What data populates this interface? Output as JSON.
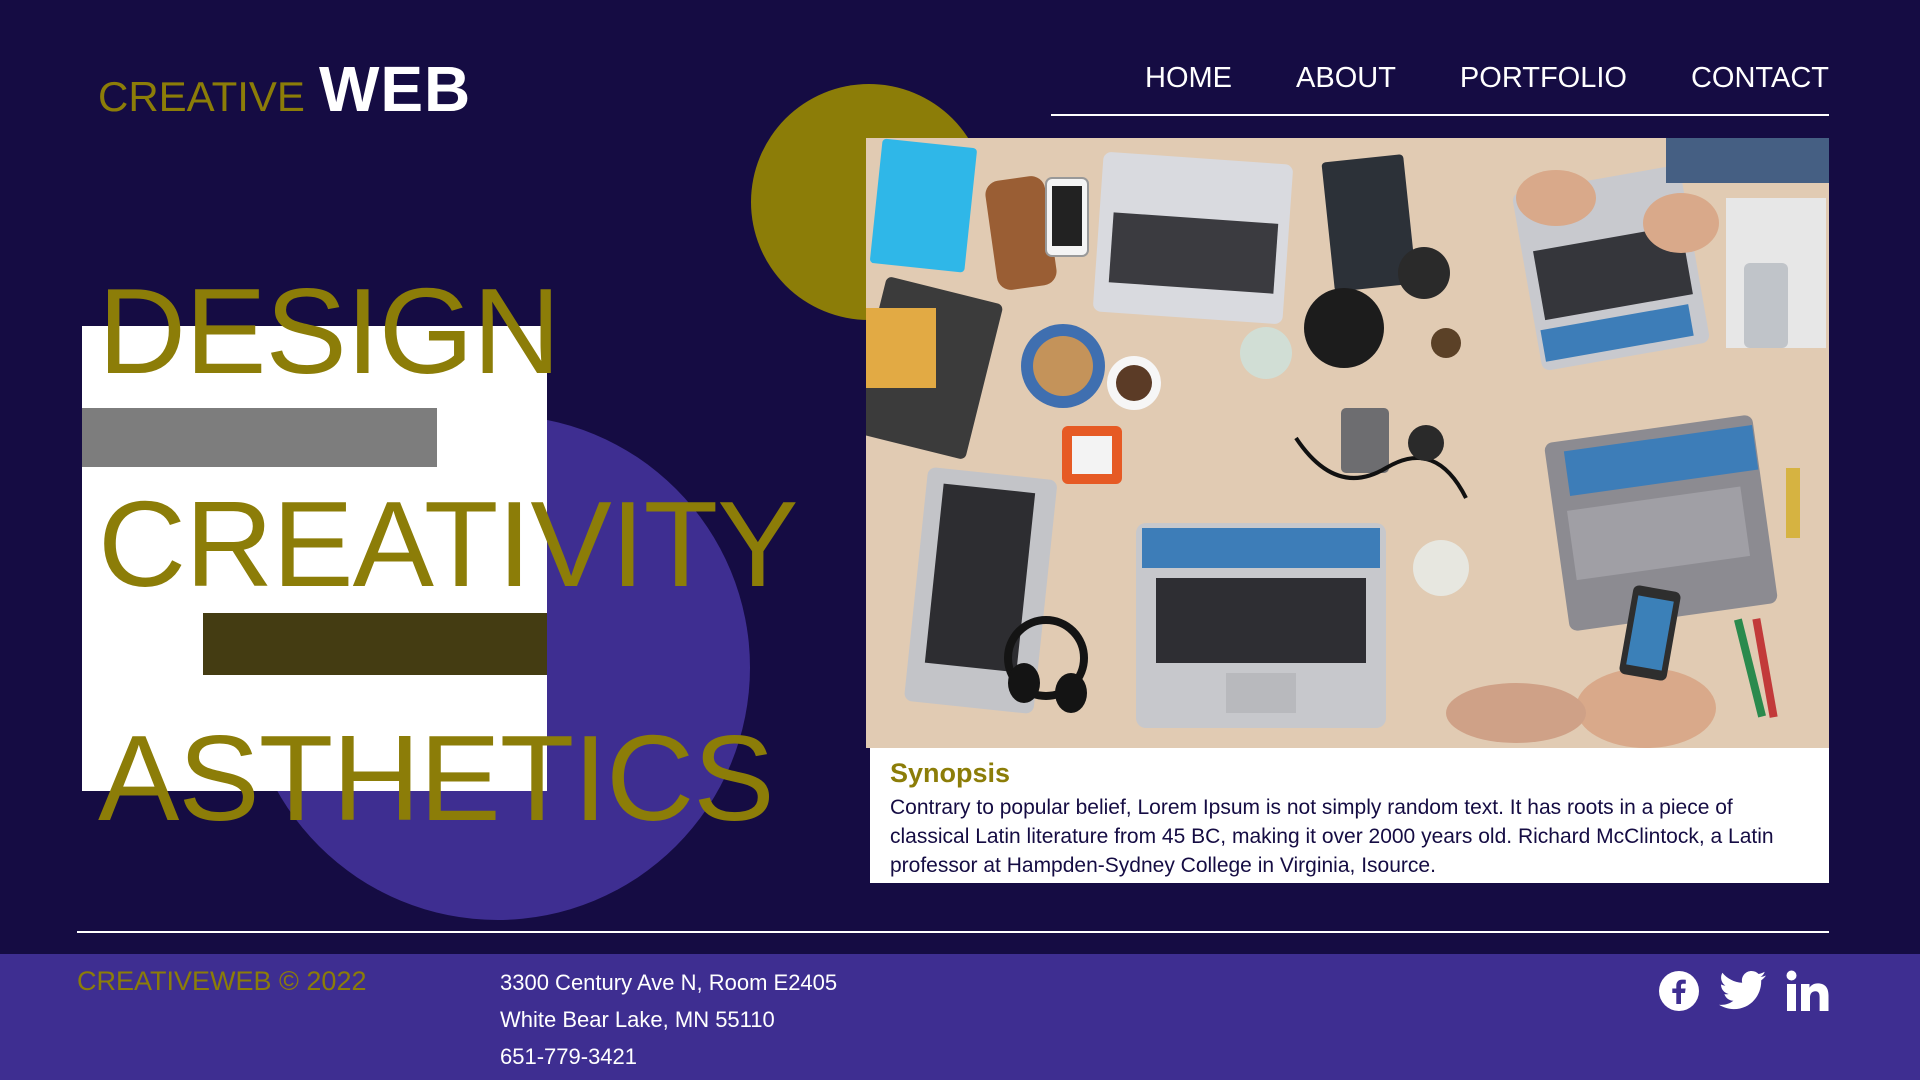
{
  "brand": {
    "logo_light": "CREATIVE",
    "logo_bold": "WEB"
  },
  "nav": {
    "items": [
      {
        "label": "HOME"
      },
      {
        "label": "ABOUT"
      },
      {
        "label": "PORTFOLIO"
      },
      {
        "label": "CONTACT"
      }
    ]
  },
  "hero": {
    "words": [
      "DESIGN",
      "CREATIVITY",
      "ASTHETICS"
    ],
    "image_description": "top-down view of a wooden table with laptops, phones, headphones and people working"
  },
  "synopsis": {
    "title": "Synopsis",
    "text": "Contrary to popular belief, Lorem Ipsum is not simply random text. It has roots in a piece of classical Latin literature from 45 BC, making it over 2000 years old. Richard McClintock, a Latin professor at Hampden-Sydney College in Virginia, Isource."
  },
  "footer": {
    "copyright": "CREATIVEWEB © 2022",
    "address_lines": [
      "3300 Century Ave N, Room E2405",
      "White Bear Lake, MN 55110",
      "651-779-3421"
    ],
    "social_icons": [
      "facebook-icon",
      "twitter-icon",
      "linkedin-icon"
    ]
  },
  "colors": {
    "background": "#150c43",
    "accent_gold": "#8c7d08",
    "accent_purple": "#3e2e91",
    "olive_bar": "#443c12",
    "gray_bar": "#7d7d7d",
    "white": "#ffffff"
  }
}
